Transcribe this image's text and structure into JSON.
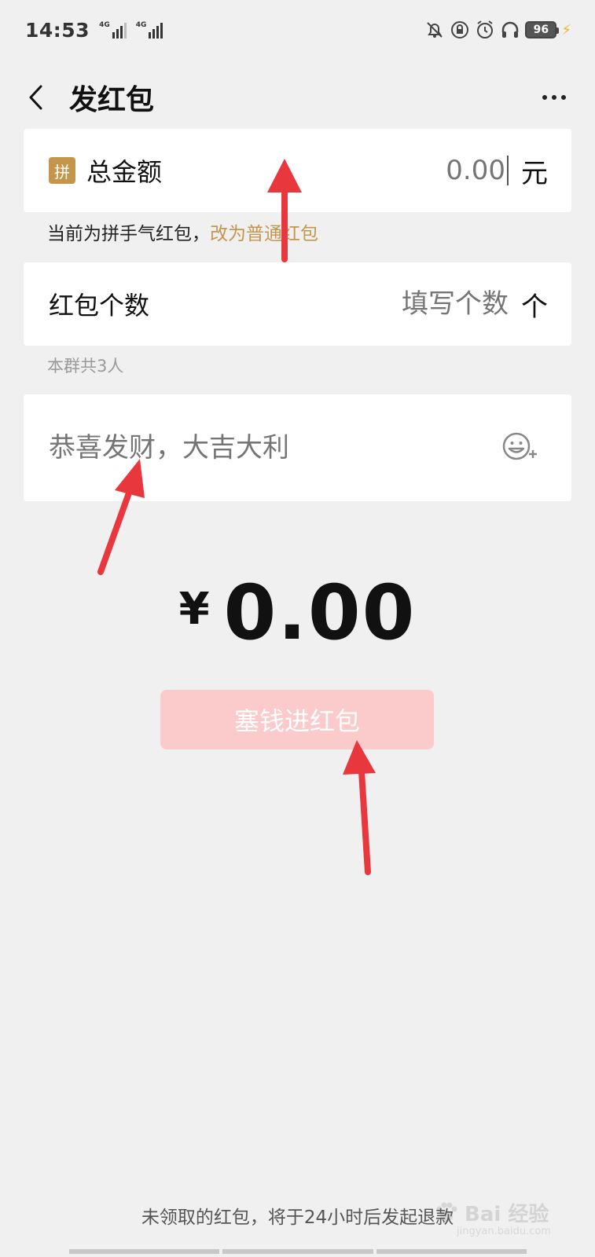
{
  "status_bar": {
    "time": "14:53",
    "network_1": "4G",
    "network_2": "4G",
    "battery": "96",
    "icons": [
      "bell-off-icon",
      "lock-icon",
      "alarm-icon",
      "headphones-icon",
      "battery-icon",
      "charging-icon"
    ]
  },
  "nav": {
    "title": "发红包",
    "back_icon": "chevron-left-icon",
    "more_icon": "more-dots-icon"
  },
  "amount_row": {
    "badge": "拼",
    "label": "总金额",
    "value": "0.00",
    "unit": "元"
  },
  "type_hint": {
    "text": "当前为拼手气红包，",
    "link": "改为普通红包"
  },
  "count_row": {
    "label": "红包个数",
    "placeholder": "填写个数",
    "unit": "个"
  },
  "group_hint": "本群共3人",
  "greeting": {
    "placeholder": "恭喜发财，大吉大利",
    "emoji_icon": "emoji-add-icon"
  },
  "total": {
    "currency": "¥",
    "value": "0.00"
  },
  "send_button": "塞钱进红包",
  "refund_note": "未领取的红包，将于24小时后发起退款",
  "watermark": {
    "text": "Bai 经验",
    "sub": "jingyan.baidu.com"
  },
  "colors": {
    "accent_gold": "#c4964b",
    "button_disabled": "#fbcaca",
    "annotation_arrow": "#e8383d"
  }
}
